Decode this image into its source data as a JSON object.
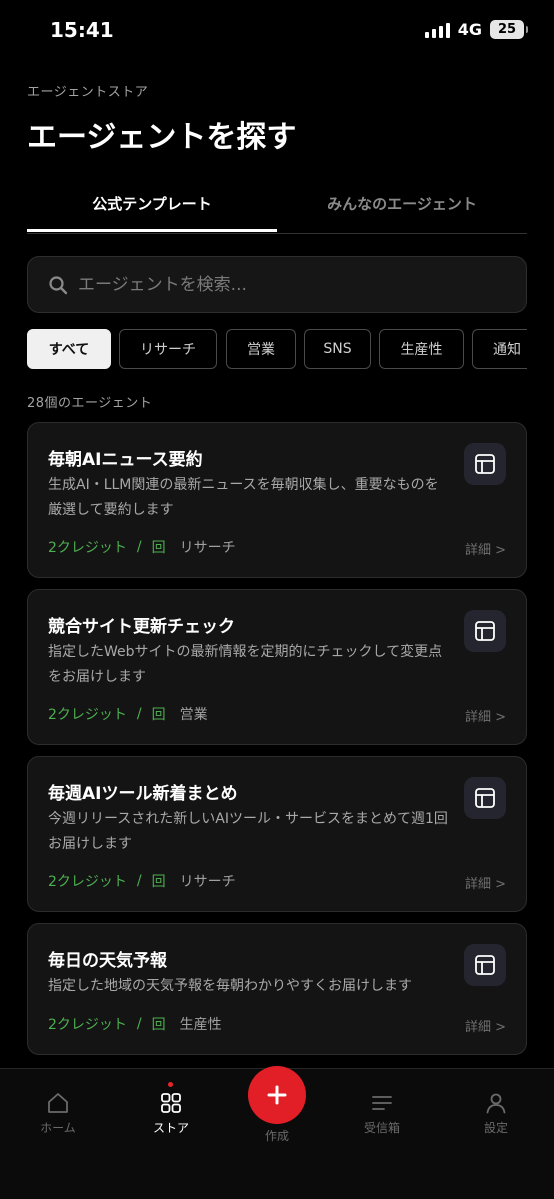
{
  "status": {
    "time": "15:41",
    "network": "4G",
    "battery": "25"
  },
  "header": {
    "breadcrumb": "エージェントストア",
    "title": "エージェントを探す"
  },
  "tabs": [
    {
      "label": "公式テンプレート"
    },
    {
      "label": "みんなのエージェント"
    }
  ],
  "search": {
    "placeholder": "エージェントを検索..."
  },
  "chips": [
    {
      "label": "すべて"
    },
    {
      "label": "リサーチ"
    },
    {
      "label": "営業"
    },
    {
      "label": "SNS"
    },
    {
      "label": "生産性"
    },
    {
      "label": "通知"
    }
  ],
  "count_label": "28個のエージェント",
  "cards": [
    {
      "title": "毎朝AIニュース要約",
      "desc": "生成AI・LLM関連の最新ニュースを毎朝収集し、重要なものを厳選して要約します",
      "credits": "2クレジット",
      "sep": "/",
      "per": "回",
      "category": "リサーチ",
      "detail": "詳細 >"
    },
    {
      "title": "競合サイト更新チェック",
      "desc": "指定したWebサイトの最新情報を定期的にチェックして変更点をお届けします",
      "credits": "2クレジット",
      "sep": "/",
      "per": "回",
      "category": "営業",
      "detail": "詳細 >"
    },
    {
      "title": "毎週AIツール新着まとめ",
      "desc": "今週リリースされた新しいAIツール・サービスをまとめて週1回お届けします",
      "credits": "2クレジット",
      "sep": "/",
      "per": "回",
      "category": "リサーチ",
      "detail": "詳細 >"
    },
    {
      "title": "毎日の天気予報",
      "desc": "指定した地域の天気予報を毎朝わかりやすくお届けします",
      "credits": "2クレジット",
      "sep": "/",
      "per": "回",
      "category": "生産性",
      "detail": "詳細 >"
    }
  ],
  "nav": {
    "home": "ホーム",
    "store": "ストア",
    "create": "作成",
    "inbox": "受信箱",
    "settings": "設定"
  }
}
